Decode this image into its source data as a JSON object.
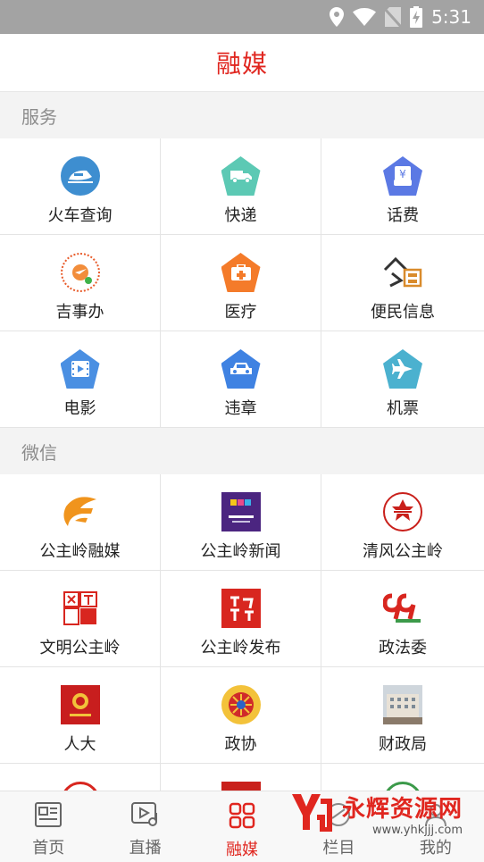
{
  "status_bar": {
    "time": "5:31",
    "icons": [
      "location-icon",
      "wifi-icon",
      "no-sim-icon",
      "battery-charging-icon"
    ]
  },
  "header": {
    "title": "融媒"
  },
  "sections": [
    {
      "title": "服务",
      "items": [
        {
          "label": "火车查询",
          "icon": "train-icon",
          "color": "#3e8ed0"
        },
        {
          "label": "快递",
          "icon": "delivery-truck-icon",
          "color": "#5cc9b4"
        },
        {
          "label": "话费",
          "icon": "yen-phone-bill-icon",
          "color": "#5b79e4"
        },
        {
          "label": "吉事办",
          "icon": "jishiban-qr-logo",
          "color": "#e85b2a"
        },
        {
          "label": "医疗",
          "icon": "medical-kit-icon",
          "color": "#f47b2a"
        },
        {
          "label": "便民信息",
          "icon": "bianmin-logo",
          "color": "#d98b2c"
        },
        {
          "label": "电影",
          "icon": "film-icon",
          "color": "#4a8fe2"
        },
        {
          "label": "违章",
          "icon": "car-icon",
          "color": "#3f82e2"
        },
        {
          "label": "机票",
          "icon": "airplane-icon",
          "color": "#4bb1cf"
        }
      ]
    },
    {
      "title": "微信",
      "items": [
        {
          "label": "公主岭融媒",
          "icon": "gzl-rongmei-logo",
          "color": "#f0941d"
        },
        {
          "label": "公主岭新闻",
          "icon": "gzl-news-logo",
          "color": "#5a2a8a"
        },
        {
          "label": "清风公主岭",
          "icon": "qingfeng-logo",
          "color": "#c9201b"
        },
        {
          "label": "文明公主岭",
          "icon": "wenming-logo",
          "color": "#d8261f"
        },
        {
          "label": "公主岭发布",
          "icon": "gzl-fabu-logo",
          "color": "#d8261f"
        },
        {
          "label": "政法委",
          "icon": "zhengfawei-logo",
          "color": "#d8261f"
        },
        {
          "label": "人大",
          "icon": "renda-emblem",
          "color": "#c81e1e"
        },
        {
          "label": "政协",
          "icon": "zhengxie-emblem",
          "color": "#d02a2a"
        },
        {
          "label": "财政局",
          "icon": "caizhengju-building-photo",
          "color": "#8a7a6a"
        }
      ]
    }
  ],
  "partial_row": [
    {
      "icon": "partial-logo-1",
      "color": "#d8261f"
    },
    {
      "icon": "partial-logo-2",
      "color": "#c9201b"
    },
    {
      "icon": "partial-logo-3",
      "color": "#3c9a4a"
    }
  ],
  "tabbar": {
    "tabs": [
      {
        "label": "首页",
        "icon": "news-icon"
      },
      {
        "label": "直播",
        "icon": "live-video-icon"
      },
      {
        "label": "融媒",
        "icon": "grid-apps-icon",
        "active": true
      },
      {
        "label": "栏目",
        "icon": "column-icon"
      },
      {
        "label": "我的",
        "icon": "user-icon"
      }
    ]
  },
  "watermark": {
    "title": "永辉资源网",
    "url": "www.yhkjjj.com"
  }
}
